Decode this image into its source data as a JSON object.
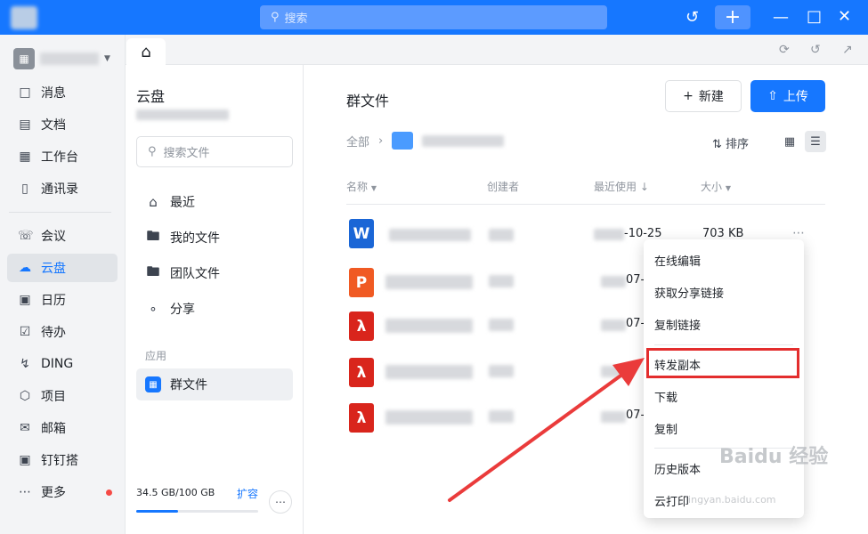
{
  "topbar": {
    "search_placeholder": "搜索"
  },
  "nav": {
    "items": [
      {
        "label": "消息",
        "icon": "message-icon"
      },
      {
        "label": "文档",
        "icon": "doc-icon"
      },
      {
        "label": "工作台",
        "icon": "grid-icon"
      },
      {
        "label": "通讯录",
        "icon": "contacts-icon"
      },
      {
        "label": "会议",
        "icon": "phone-icon"
      },
      {
        "label": "云盘",
        "icon": "cloud-icon"
      },
      {
        "label": "日历",
        "icon": "calendar-icon"
      },
      {
        "label": "待办",
        "icon": "todo-icon"
      },
      {
        "label": "DING",
        "icon": "lightning-icon"
      },
      {
        "label": "项目",
        "icon": "project-icon"
      },
      {
        "label": "邮箱",
        "icon": "mail-icon"
      },
      {
        "label": "钉钉搭",
        "icon": "build-icon"
      },
      {
        "label": "更多",
        "icon": "more-icon"
      }
    ],
    "active": "云盘"
  },
  "drive": {
    "title": "云盘",
    "search_placeholder": "搜索文件",
    "items": [
      "最近",
      "我的文件",
      "团队文件",
      "分享"
    ],
    "apps_label": "应用",
    "group_files": "群文件",
    "storage": "34.5 GB/100 GB",
    "storage_fraction": 0.345,
    "expand": "扩容"
  },
  "main": {
    "title": "群文件",
    "new_label": "新建",
    "upload_label": "上传",
    "breadcrumb_root": "全部",
    "sort_label": "排序",
    "columns": {
      "name": "名称",
      "creator": "创建者",
      "recent": "最近使用",
      "size": "大小"
    },
    "rows": [
      {
        "type": "W",
        "date": "-10-25",
        "size": "703 KB"
      },
      {
        "type": "P",
        "date": "07-",
        "size": ""
      },
      {
        "type": "PDF",
        "date": "07-",
        "size": ""
      },
      {
        "type": "PDF",
        "date": "",
        "size": ""
      },
      {
        "type": "PDF",
        "date": "07-",
        "size": ""
      }
    ]
  },
  "menu": {
    "items": [
      "在线编辑",
      "获取分享链接",
      "复制链接",
      "转发副本",
      "下载",
      "复制",
      "历史版本",
      "云打印"
    ],
    "highlighted": "转发副本"
  },
  "watermark": {
    "brand": "Baidu 经验",
    "url": "jingyan.baidu.com"
  }
}
